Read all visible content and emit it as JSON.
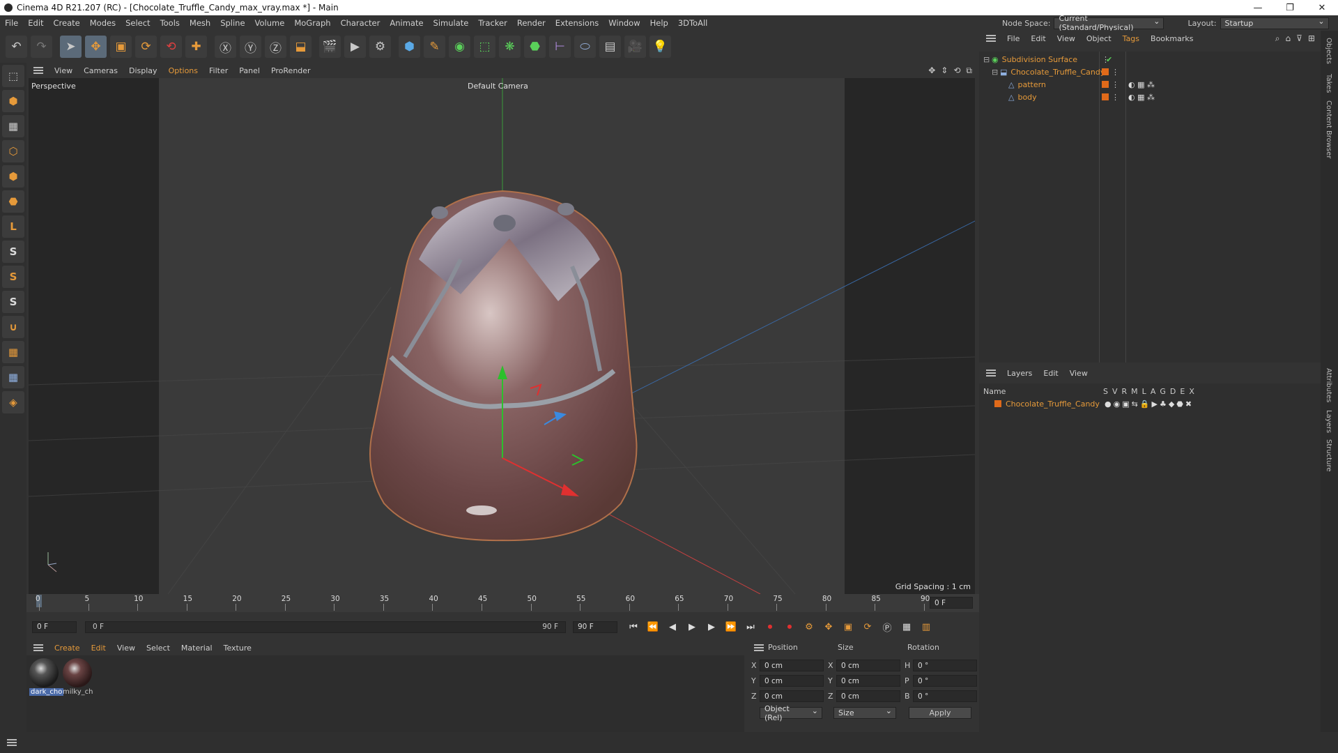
{
  "window": {
    "title": "Cinema 4D R21.207 (RC) - [Chocolate_Truffle_Candy_max_vray.max *] - Main"
  },
  "menubar": {
    "items": [
      "File",
      "Edit",
      "Create",
      "Modes",
      "Select",
      "Tools",
      "Mesh",
      "Spline",
      "Volume",
      "MoGraph",
      "Character",
      "Animate",
      "Simulate",
      "Tracker",
      "Render",
      "Extensions",
      "Window",
      "Help",
      "3DToAll"
    ],
    "node_space_label": "Node Space:",
    "node_space_value": "Current (Standard/Physical)",
    "layout_label": "Layout:",
    "layout_value": "Startup"
  },
  "viewport": {
    "menu": [
      "View",
      "Cameras",
      "Display",
      "Options",
      "Filter",
      "Panel",
      "ProRender"
    ],
    "label": "Perspective",
    "camera": "Default Camera",
    "grid_spacing": "Grid Spacing : 1 cm"
  },
  "timeline": {
    "ticks": [
      "0",
      "5",
      "10",
      "15",
      "20",
      "25",
      "30",
      "35",
      "40",
      "45",
      "50",
      "55",
      "60",
      "65",
      "70",
      "75",
      "80",
      "85",
      "90"
    ],
    "current_frame": "0 F",
    "start_field": "0 F",
    "range_start": "0 F",
    "range_end": "90 F",
    "end_field": "90 F",
    "end_frame": "0 F"
  },
  "materials": {
    "menu": [
      "Create",
      "Edit",
      "View",
      "Select",
      "Material",
      "Texture"
    ],
    "items": [
      {
        "name": "dark_cho"
      },
      {
        "name": "milky_ch"
      }
    ]
  },
  "attributes": {
    "headers": [
      "Position",
      "Size",
      "Rotation"
    ],
    "rows": [
      {
        "axis": "X",
        "pos": "0 cm",
        "size_axis": "X",
        "size": "0 cm",
        "rot_axis": "H",
        "rot": "0 °"
      },
      {
        "axis": "Y",
        "pos": "0 cm",
        "size_axis": "Y",
        "size": "0 cm",
        "rot_axis": "P",
        "rot": "0 °"
      },
      {
        "axis": "Z",
        "pos": "0 cm",
        "size_axis": "Z",
        "size": "0 cm",
        "rot_axis": "B",
        "rot": "0 °"
      }
    ],
    "coord_mode": "Object (Rel)",
    "size_mode": "Size",
    "apply": "Apply"
  },
  "objects": {
    "menu": [
      "File",
      "Edit",
      "View",
      "Object",
      "Tags",
      "Bookmarks"
    ],
    "tree": [
      "Subdivision Surface",
      "Chocolate_Truffle_Candy",
      "pattern",
      "body"
    ]
  },
  "layers": {
    "menu": [
      "Layers",
      "Edit",
      "View"
    ],
    "name_header": "Name",
    "cols": [
      "S",
      "V",
      "R",
      "M",
      "L",
      "A",
      "G",
      "D",
      "E",
      "X"
    ],
    "items": [
      "Chocolate_Truffle_Candy"
    ]
  },
  "side_tabs": [
    "Objects",
    "Takes",
    "Content Browser",
    "Attributes",
    "Layers",
    "Structure"
  ],
  "colors": {
    "accent": "#e69a3a",
    "layer_color": "#e06a1a"
  }
}
